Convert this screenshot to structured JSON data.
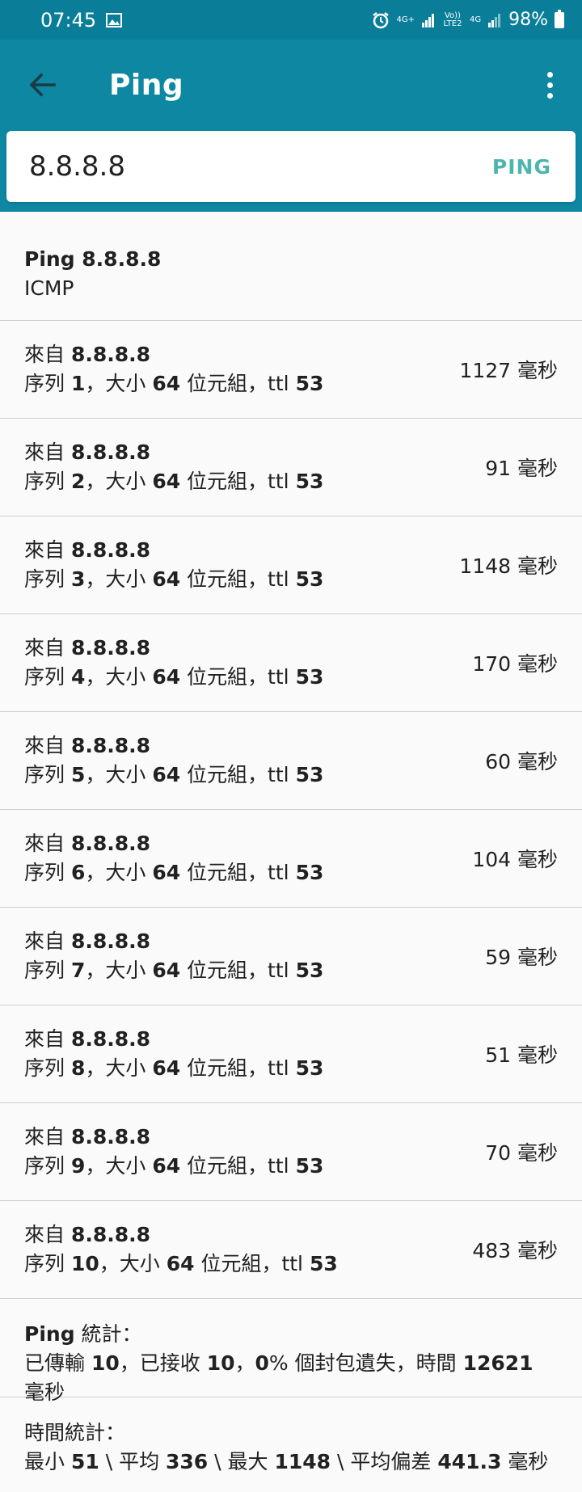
{
  "status_bar": {
    "time": "07:45",
    "image_icon": "image-icon",
    "alarm_icon": "alarm-icon",
    "net1": "4G+",
    "volte": "Vo)) LTE2",
    "net2": "4G",
    "battery": "98%"
  },
  "app_bar": {
    "title": "Ping",
    "back_icon": "arrow-back-icon",
    "menu_icon": "more-vert-icon"
  },
  "search": {
    "value": "8.8.8.8",
    "button_label": "PING"
  },
  "header": {
    "line1": "Ping 8.8.8.8",
    "line2": "ICMP"
  },
  "rows": [
    {
      "from": "來自 ",
      "host": "8.8.8.8",
      "seq_label": "序列 ",
      "seq": "1",
      "sep1": "，大小 ",
      "size": "64",
      "sep2": " 位元組，ttl ",
      "ttl": "53",
      "time": "1127 毫秒"
    },
    {
      "from": "來自 ",
      "host": "8.8.8.8",
      "seq_label": "序列 ",
      "seq": "2",
      "sep1": "，大小 ",
      "size": "64",
      "sep2": " 位元組，ttl ",
      "ttl": "53",
      "time": "91 毫秒"
    },
    {
      "from": "來自 ",
      "host": "8.8.8.8",
      "seq_label": "序列 ",
      "seq": "3",
      "sep1": "，大小 ",
      "size": "64",
      "sep2": " 位元組，ttl ",
      "ttl": "53",
      "time": "1148 毫秒"
    },
    {
      "from": "來自 ",
      "host": "8.8.8.8",
      "seq_label": "序列 ",
      "seq": "4",
      "sep1": "，大小 ",
      "size": "64",
      "sep2": " 位元組，ttl ",
      "ttl": "53",
      "time": "170 毫秒"
    },
    {
      "from": "來自 ",
      "host": "8.8.8.8",
      "seq_label": "序列 ",
      "seq": "5",
      "sep1": "，大小 ",
      "size": "64",
      "sep2": " 位元組，ttl ",
      "ttl": "53",
      "time": "60 毫秒"
    },
    {
      "from": "來自 ",
      "host": "8.8.8.8",
      "seq_label": "序列 ",
      "seq": "6",
      "sep1": "，大小 ",
      "size": "64",
      "sep2": " 位元組，ttl ",
      "ttl": "53",
      "time": "104 毫秒"
    },
    {
      "from": "來自 ",
      "host": "8.8.8.8",
      "seq_label": "序列 ",
      "seq": "7",
      "sep1": "，大小 ",
      "size": "64",
      "sep2": " 位元組，ttl ",
      "ttl": "53",
      "time": "59 毫秒"
    },
    {
      "from": "來自 ",
      "host": "8.8.8.8",
      "seq_label": "序列 ",
      "seq": "8",
      "sep1": "，大小 ",
      "size": "64",
      "sep2": " 位元組，ttl ",
      "ttl": "53",
      "time": "51 毫秒"
    },
    {
      "from": "來自 ",
      "host": "8.8.8.8",
      "seq_label": "序列 ",
      "seq": "9",
      "sep1": "，大小 ",
      "size": "64",
      "sep2": " 位元組，ttl ",
      "ttl": "53",
      "time": "70 毫秒"
    },
    {
      "from": "來自 ",
      "host": "8.8.8.8",
      "seq_label": "序列 ",
      "seq": "10",
      "sep1": "，大小 ",
      "size": "64",
      "sep2": " 位元組，ttl ",
      "ttl": "53",
      "time": "483 毫秒"
    }
  ],
  "ping_stats": {
    "title_a": "Ping",
    "title_b": " 統計：",
    "sent_label": "已傳輸 ",
    "sent": "10",
    "recv_label": "，已接收 ",
    "recv": "10",
    "sep": "，",
    "loss": "0",
    "loss_label": "% 個封包遺失，時間 ",
    "time": "12621",
    "time_unit": " 毫秒"
  },
  "time_stats": {
    "title": "時間統計：",
    "min_label": "最小 ",
    "min": "51",
    "avg_label": " \\ 平均 ",
    "avg": "336",
    "max_label": " \\ 最大 ",
    "max": "1148",
    "mdev_label": " \\ 平均偏差 ",
    "mdev": "441.3",
    "unit": " 毫秒"
  }
}
